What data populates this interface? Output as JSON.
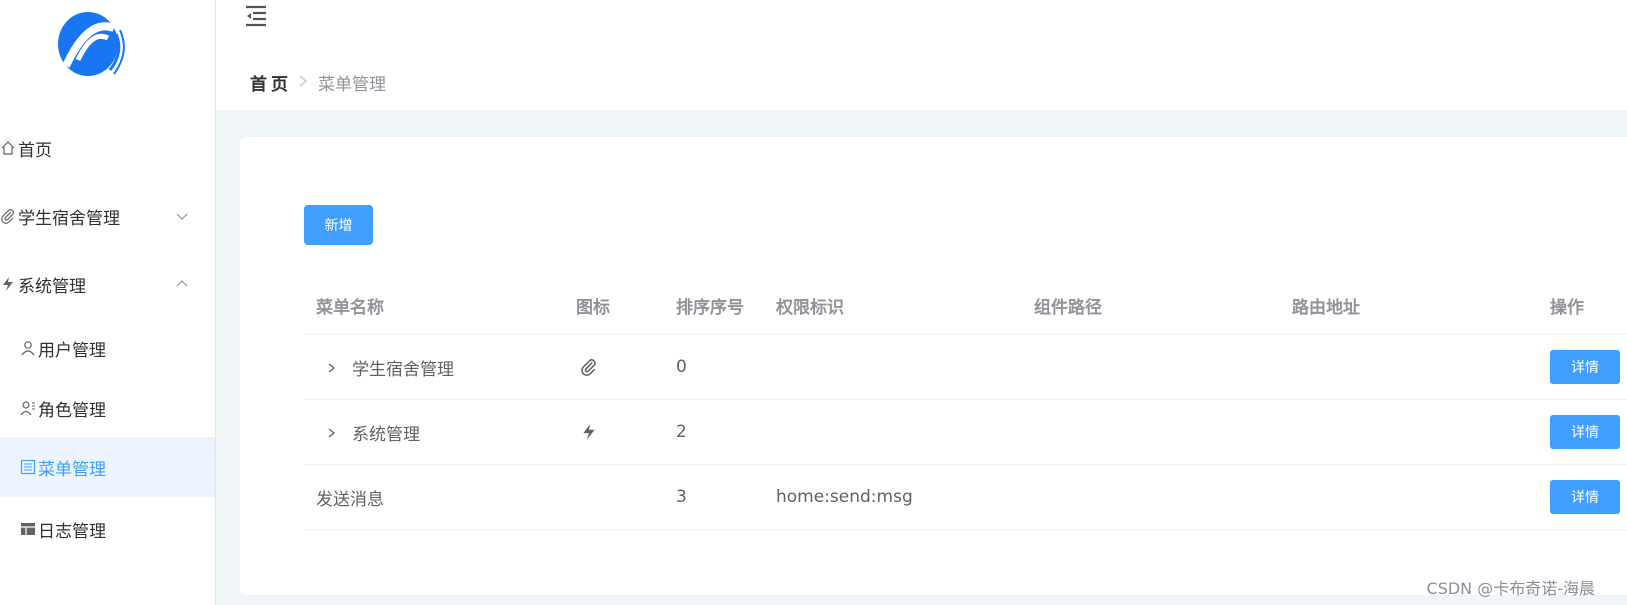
{
  "sidebar": {
    "items": [
      {
        "label": "首页",
        "icon": "home-icon"
      },
      {
        "label": "学生宿舍管理",
        "icon": "paperclip-icon"
      },
      {
        "label": "系统管理",
        "icon": "lightning-icon"
      },
      {
        "label": "用户管理",
        "icon": "user-icon"
      },
      {
        "label": "角色管理",
        "icon": "user-role-icon"
      },
      {
        "label": "菜单管理",
        "icon": "list-icon"
      },
      {
        "label": "日志管理",
        "icon": "table-icon"
      }
    ],
    "active": "菜单管理"
  },
  "breadcrumb": {
    "home": "首页",
    "current": "菜单管理"
  },
  "toolbar": {
    "add_label": "新增"
  },
  "table": {
    "headers": [
      "菜单名称",
      "图标",
      "排序序号",
      "权限标识",
      "组件路径",
      "路由地址",
      "操作"
    ],
    "rows": [
      {
        "name": "学生宿舍管理",
        "icon": "paperclip-icon",
        "order": "0",
        "perm": "",
        "component": "",
        "route": "",
        "action": "详情",
        "expandable": true
      },
      {
        "name": "系统管理",
        "icon": "lightning-icon",
        "order": "2",
        "perm": "",
        "component": "",
        "route": "",
        "action": "详情",
        "expandable": true
      },
      {
        "name": "发送消息",
        "icon": "",
        "order": "3",
        "perm": "home:send:msg",
        "component": "",
        "route": "",
        "action": "详情",
        "expandable": false
      }
    ]
  },
  "watermark": "CSDN @卡布奇诺-海晨",
  "colors": {
    "primary": "#409eff",
    "active_bg": "#ecf5ff",
    "page_bg": "#f0f5f7"
  }
}
